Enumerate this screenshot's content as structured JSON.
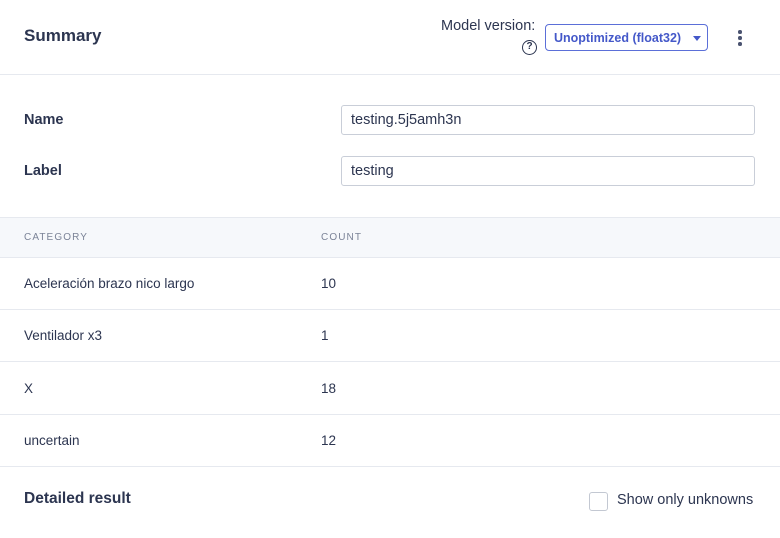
{
  "header": {
    "title": "Summary",
    "model_version_label": "Model version:",
    "help_icon": "question-circle-icon",
    "model_version_value": "Unoptimized (float32)",
    "menu_icon": "kebab-menu-icon"
  },
  "form": {
    "name_label": "Name",
    "name_value": "testing.5j5amh3n",
    "label_label": "Label",
    "label_value": "testing"
  },
  "table": {
    "headers": [
      "CATEGORY",
      "COUNT"
    ],
    "rows": [
      {
        "category": "Aceleración brazo nico largo",
        "count": "10"
      },
      {
        "category": "Ventilador x3",
        "count": "1"
      },
      {
        "category": "X",
        "count": "18"
      },
      {
        "category": "uncertain",
        "count": "12"
      }
    ]
  },
  "footer": {
    "detailed_title": "Detailed result",
    "show_unknowns_label": "Show only unknowns",
    "show_unknowns_checked": false
  },
  "colors": {
    "accent": "#4458c9",
    "text": "#2c3550",
    "muted": "#7b8397",
    "border": "#e6e9ef",
    "table_header_bg": "#f6f8fb"
  }
}
